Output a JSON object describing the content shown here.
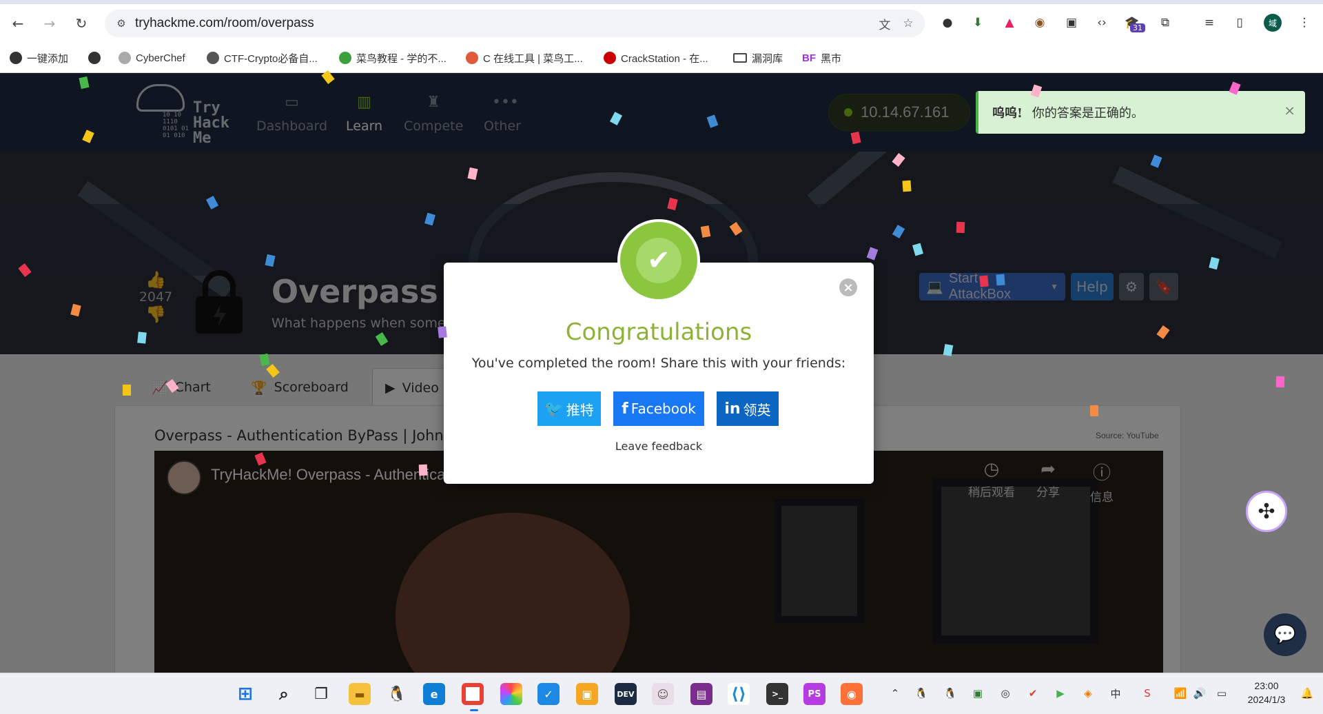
{
  "browser": {
    "url": "tryhackme.com/room/overpass",
    "extension_badge": "31",
    "profile_initial": "域",
    "bookmarks": [
      {
        "label": "一键添加",
        "icon": "globe-icon"
      },
      {
        "label": "",
        "icon": "globe-icon"
      },
      {
        "label": "CyberChef",
        "icon": "chef-icon"
      },
      {
        "label": "CTF-Crypto必备自...",
        "icon": "ctf-icon"
      },
      {
        "label": "菜鸟教程 - 学的不...",
        "icon": "runoob-icon"
      },
      {
        "label": "C 在线工具 | 菜鸟工...",
        "icon": "code-icon"
      },
      {
        "label": "CrackStation - 在...",
        "icon": "crackstation-icon"
      },
      {
        "label": "漏洞库",
        "icon": "folder-icon"
      },
      {
        "label": "黑市",
        "icon": "bf-icon",
        "prefix": "BF"
      }
    ]
  },
  "nav": {
    "logo_binary": "10 10\n1110\n0101 01\n01 010",
    "logo_lines": [
      "Try",
      "Hack",
      "Me"
    ],
    "items": [
      {
        "label": "Dashboard",
        "icon": "dashboard-icon"
      },
      {
        "label": "Learn",
        "icon": "book-icon"
      },
      {
        "label": "Compete",
        "icon": "trophy-icon"
      },
      {
        "label": "Other",
        "icon": "more-icon"
      }
    ],
    "ip": "10.14.67.161"
  },
  "toast": {
    "strong": "呜呜!",
    "message": "你的答案是正确的。",
    "close": "×"
  },
  "room": {
    "votes": "2047",
    "title": "Overpass",
    "subtitle": "What happens when some",
    "start_attackbox": "Start AttackBox",
    "help": "Help"
  },
  "tabs": [
    {
      "label": "Chart",
      "icon": "chart-icon"
    },
    {
      "label": "Scoreboard",
      "icon": "trophy-icon"
    },
    {
      "label": "Video",
      "icon": "play-icon"
    }
  ],
  "video": {
    "heading": "Overpass - Authentication ByPass | John H",
    "source": "Source: YouTube",
    "title": "TryHackMe! Overpass - Authentica",
    "controls": [
      {
        "label": "稍后观看",
        "icon": "clock-icon"
      },
      {
        "label": "分享",
        "icon": "share-icon"
      },
      {
        "label": "信息",
        "icon": "info-icon"
      }
    ]
  },
  "modal": {
    "title": "Congratulations",
    "message": "You've completed the room! Share this with your friends:",
    "share": [
      {
        "label": "推特",
        "icon_text": "🐦",
        "color": "#1da1f2"
      },
      {
        "label": "Facebook",
        "icon_text": "f",
        "color": "#1877f2"
      },
      {
        "label": "领英",
        "icon_text": "in",
        "color": "#0a66c2"
      }
    ],
    "feedback": "Leave feedback",
    "close": "×"
  },
  "taskbar": {
    "time": "23:00",
    "date": "2024/1/3"
  },
  "colors": {
    "thm_nav": "#212c42",
    "success_green": "#8cc63f",
    "toast_bg": "#d8f0d3"
  }
}
